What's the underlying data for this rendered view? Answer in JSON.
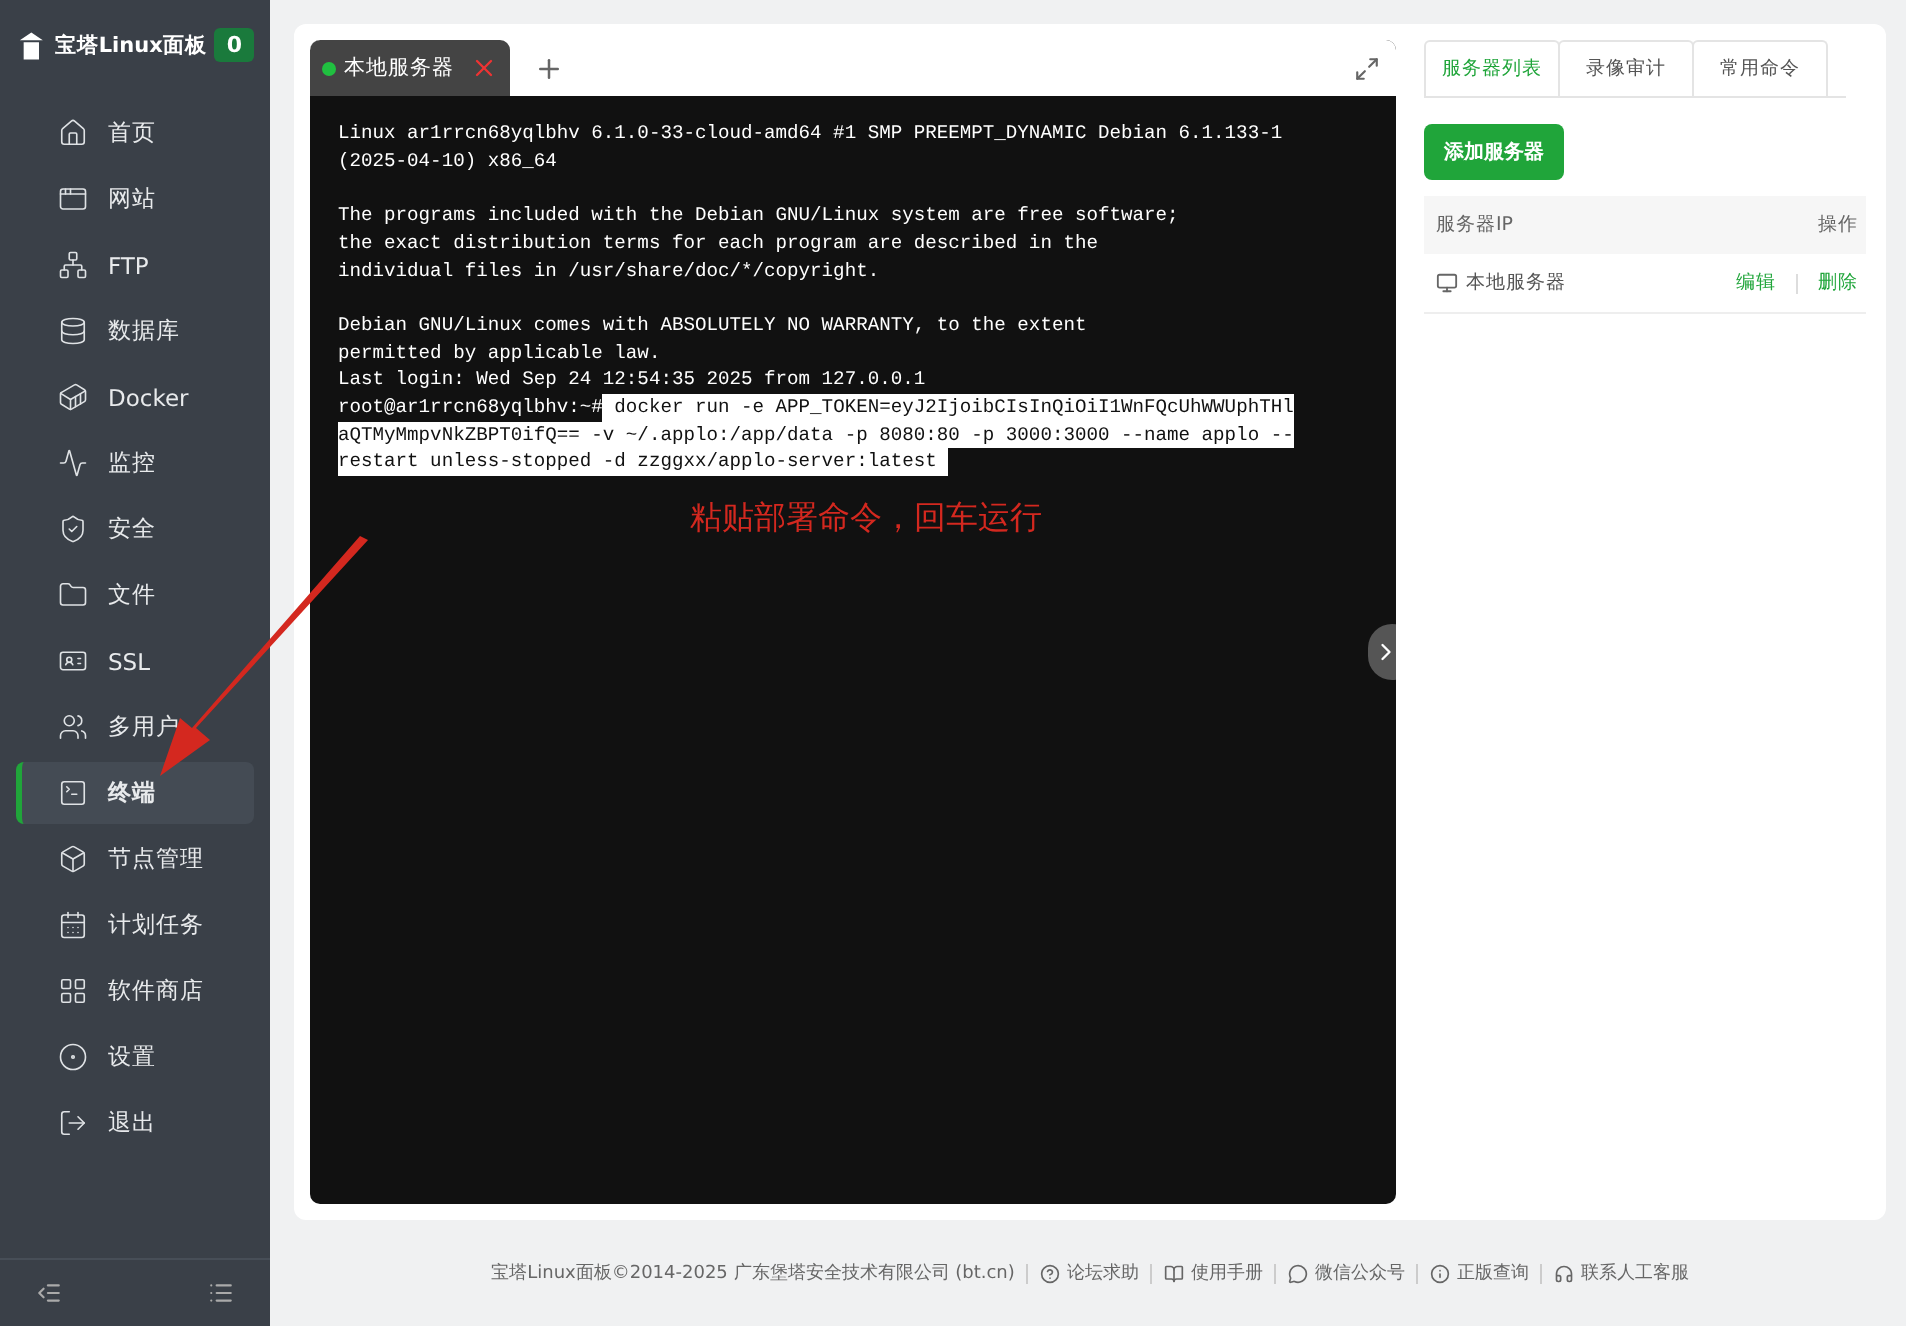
{
  "brand": {
    "title": "宝塔Linux面板",
    "badge": "0"
  },
  "sidebar": {
    "items": [
      {
        "label": "首页",
        "selected": false
      },
      {
        "label": "网站",
        "selected": false
      },
      {
        "label": "FTP",
        "selected": false
      },
      {
        "label": "数据库",
        "selected": false
      },
      {
        "label": "Docker",
        "selected": false
      },
      {
        "label": "监控",
        "selected": false
      },
      {
        "label": "安全",
        "selected": false
      },
      {
        "label": "文件",
        "selected": false
      },
      {
        "label": "SSL",
        "selected": false
      },
      {
        "label": "多用户",
        "selected": false
      },
      {
        "label": "终端",
        "selected": true
      },
      {
        "label": "节点管理",
        "selected": false
      },
      {
        "label": "计划任务",
        "selected": false
      },
      {
        "label": "软件商店",
        "selected": false
      },
      {
        "label": "设置",
        "selected": false
      },
      {
        "label": "退出",
        "selected": false
      }
    ]
  },
  "terminal": {
    "tabs": [
      {
        "label": "本地服务器",
        "selected": true,
        "connected": true
      }
    ],
    "blocks": [
      [
        [
          {
            "text": "Linux ar1rrcn68yqlbhv 6.1.0-33-cloud-amd64 #1 SMP PREEMPT_DYNAMIC Debian 6.1.133-1",
            "selected": false
          }
        ],
        [
          {
            "text": "(2025-04-10) x86_64",
            "selected": false
          }
        ]
      ],
      [
        [
          {
            "text": "The programs included with the Debian GNU/Linux system are free software;",
            "selected": false
          }
        ],
        [
          {
            "text": "the exact distribution terms for each program are described in the",
            "selected": false
          }
        ],
        [
          {
            "text": "individual files in /usr/share/doc/*/copyright.",
            "selected": false
          }
        ]
      ],
      [
        [
          {
            "text": "Debian GNU/Linux comes with ABSOLUTELY NO WARRANTY, to the extent",
            "selected": false
          }
        ],
        [
          {
            "text": "permitted by applicable law.",
            "selected": false
          }
        ],
        [
          {
            "text": "Last login: Wed Sep 24 12:54:35 2025 from 127.0.0.1",
            "selected": false
          }
        ],
        [
          {
            "text": "root@ar1rrcn68yqlbhv:~#",
            "selected": false
          },
          {
            "text": " docker run -e APP_TOKEN=eyJ2IjoibCIsInQiOiI1WnFQcUhWWUphTHl",
            "selected": true
          }
        ],
        [
          {
            "text": "aQTMyMmpvNkZBPT0ifQ== -v ~/.applo:/app/data -p 8080:80 -p 3000:3000 --name applo --",
            "selected": true
          }
        ],
        [
          {
            "text": "restart unless-stopped -d zzggxx/applo-server:latest ",
            "selected": true
          }
        ]
      ]
    ],
    "annotation": "粘贴部署命令，回车运行"
  },
  "server_panel": {
    "tabs": [
      {
        "label": "服务器列表",
        "selected": true
      },
      {
        "label": "录像审计",
        "selected": false
      },
      {
        "label": "常用命令",
        "selected": false
      }
    ],
    "add_button": "添加服务器",
    "table": {
      "columns": [
        "服务器IP",
        "操作"
      ],
      "rows": [
        {
          "name": "本地服务器",
          "actions": [
            "编辑",
            "删除"
          ]
        }
      ]
    }
  },
  "footer": {
    "copyright": "宝塔Linux面板©2014-2025 广东堡塔安全技术有限公司 (bt.cn)",
    "links": [
      "论坛求助",
      "使用手册",
      "微信公众号",
      "正版查询",
      "联系人工客服"
    ]
  }
}
